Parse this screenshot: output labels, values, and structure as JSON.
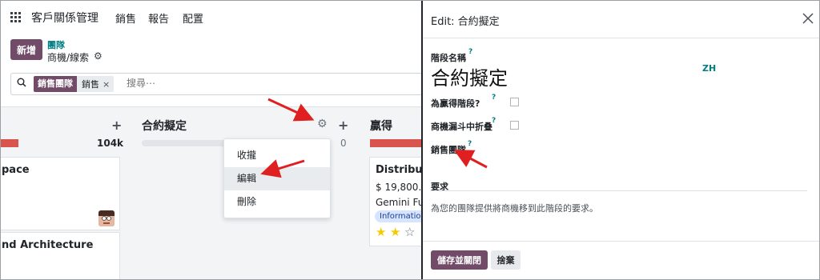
{
  "topbar": {
    "app_title": "客戶關係管理",
    "menu": [
      "銷售",
      "報告",
      "配置"
    ]
  },
  "control_panel": {
    "new_label": "新增",
    "breadcrumb_parent": "團隊",
    "breadcrumb_current": "商機/線索"
  },
  "search": {
    "facet_label": "銷售團隊",
    "facet_value": "銷售",
    "facet_remove": "×",
    "placeholder": "搜尋⋯"
  },
  "kanban": {
    "col1": {
      "amount": "104k",
      "add": "+"
    },
    "col2": {
      "title": "合約擬定",
      "add": "+",
      "count": "0"
    },
    "col3": {
      "title": "贏得"
    },
    "card1": {
      "title": "pace"
    },
    "card2": {
      "title": "nd Architecture"
    },
    "card3": {
      "title": "Distribut",
      "amount": "$ 19,800.0",
      "company": "Gemini Fu",
      "tag": "Informatio",
      "stars": [
        "★",
        "★",
        "☆"
      ]
    }
  },
  "dropdown": {
    "items": [
      "收攏",
      "編輯",
      "刪除"
    ],
    "highlighted": "編輯"
  },
  "modal": {
    "title": "Edit: 合約擬定",
    "close": "×",
    "stage_name_label": "階段名稱",
    "stage_name_value": "合約擬定",
    "lang_label": "ZH",
    "won_stage_label": "為贏得階段?",
    "won_stage_checked": false,
    "folded_label": "商機漏斗中折叠",
    "folded_checked": false,
    "sales_team_label": "銷售團隊",
    "help_mark": "?",
    "requirements_label": "要求",
    "requirements_placeholder": "為您的團隊提供將商機移到此階段的要求。",
    "save_label": "儲存並關閉",
    "discard_label": "捨棄"
  },
  "colors": {
    "primary": "#714b67",
    "link": "#017e84",
    "danger_bar": "#d9534f",
    "annotation_arrow": "#e02020"
  }
}
